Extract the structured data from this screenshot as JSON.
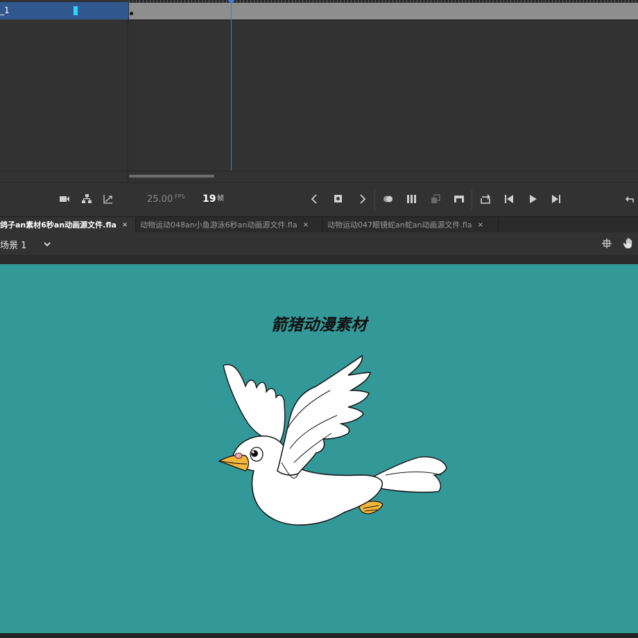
{
  "timeline": {
    "layer_name": "_1",
    "fps_value": "25.00",
    "fps_unit": "FPS",
    "current_frame": "19",
    "frame_unit": "帧",
    "icons": {
      "camera": "camera-icon",
      "layer_parenting": "layer-parenting-icon",
      "easing": "easing-icon",
      "prev_keyframe": "chevron-left-icon",
      "insert_keyframe": "insert-keyframe-icon",
      "next_keyframe": "chevron-right-icon",
      "onion_skin": "onion-skin-icon",
      "edit_multiple_frames": "edit-multiple-frames-icon",
      "onion_outlines": "onion-outlines-icon",
      "frame_center": "frame-center-icon",
      "loop": "loop-icon",
      "step_back": "step-back-icon",
      "play": "play-icon",
      "step_forward": "step-forward-icon",
      "undo": "undo-icon"
    }
  },
  "tabs": [
    {
      "label": "鸽子an素材6秒an动画源文件.fla",
      "close": "×",
      "active": true
    },
    {
      "label": "动物运动048an小鱼游泳6秒an动画源文件.fla",
      "close": "×",
      "active": false
    },
    {
      "label": "动物运动047眼镜蛇an蛇an动画源文件.fla",
      "close": "×",
      "active": false
    }
  ],
  "scene": {
    "label": "场景 1"
  },
  "stage": {
    "title": "箭猪动漫素材",
    "background": "#339998"
  },
  "colors": {
    "selected_layer": "#30578e",
    "playhead": "#3f7bd9",
    "panel": "#323232"
  }
}
